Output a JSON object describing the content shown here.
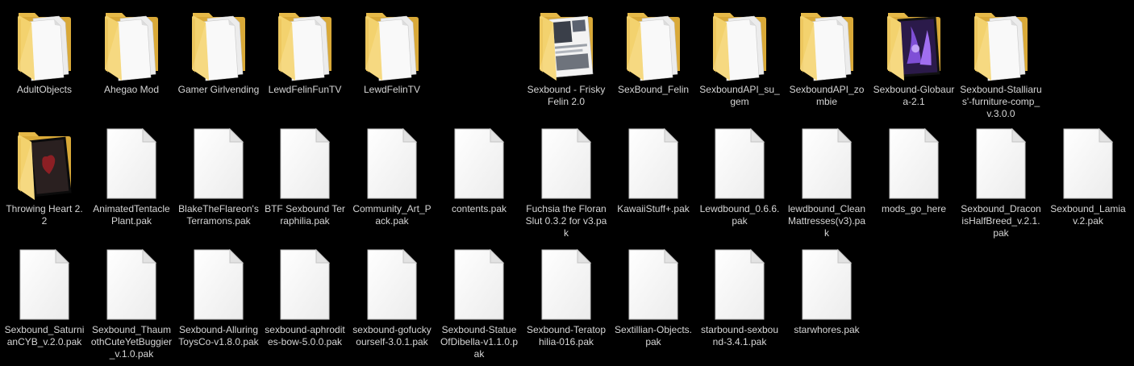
{
  "view": "large-icons",
  "colors": {
    "background": "#000000",
    "label_text": "#d6d6d6",
    "folder_yellow": "#f3d26e",
    "folder_dark": "#d9a938",
    "paper": "#f7f7f7"
  },
  "rows": [
    {
      "items": [
        {
          "label": "AdultObjects",
          "type": "folder",
          "icon": "folder-icon",
          "col": 0
        },
        {
          "label": "Ahegao Mod",
          "type": "folder",
          "icon": "folder-icon",
          "col": 1
        },
        {
          "label": "Gamer Girlvending",
          "type": "folder",
          "icon": "folder-icon",
          "col": 2
        },
        {
          "label": "LewdFelinFunTV",
          "type": "folder",
          "icon": "folder-icon",
          "col": 3
        },
        {
          "label": "LewdFelinTV",
          "type": "folder",
          "icon": "folder-icon",
          "col": 4
        },
        {
          "label": "Sexbound - Frisky Felin 2.0",
          "type": "folder-preview",
          "preview": "light",
          "icon": "folder-preview-icon",
          "col": 6
        },
        {
          "label": "SexBound_Felin",
          "type": "folder",
          "icon": "folder-icon",
          "col": 7
        },
        {
          "label": "SexboundAPI_su_gem",
          "type": "folder",
          "icon": "folder-icon",
          "col": 8
        },
        {
          "label": "SexboundAPI_zombie",
          "type": "folder",
          "icon": "folder-icon",
          "col": 9
        },
        {
          "label": "Sexbound-Globaura-2.1",
          "type": "folder-preview",
          "preview": "purple",
          "icon": "folder-preview-icon",
          "col": 10
        },
        {
          "label": "Sexbound-Stalliarus'-furniture-comp_v.3.0.0",
          "type": "folder",
          "icon": "folder-icon",
          "col": 11
        }
      ]
    },
    {
      "items": [
        {
          "label": "Throwing Heart 2.2",
          "type": "folder-preview",
          "preview": "heart",
          "icon": "folder-preview-icon",
          "col": 0
        },
        {
          "label": "AnimatedTentaclePlant.pak",
          "type": "file",
          "icon": "blank-file-icon",
          "col": 1
        },
        {
          "label": "BlakeTheFlareon's Terramons.pak",
          "type": "file",
          "icon": "blank-file-icon",
          "col": 2
        },
        {
          "label": "BTF Sexbound Terraphilia.pak",
          "type": "file",
          "icon": "blank-file-icon",
          "col": 3
        },
        {
          "label": "Community_Art_Pack.pak",
          "type": "file",
          "icon": "blank-file-icon",
          "col": 4
        },
        {
          "label": "contents.pak",
          "type": "file",
          "icon": "blank-file-icon",
          "col": 5
        },
        {
          "label": "Fuchsia the Floran Slut 0.3.2 for v3.pak",
          "type": "file",
          "icon": "blank-file-icon",
          "col": 6
        },
        {
          "label": "KawaiiStuff+.pak",
          "type": "file",
          "icon": "blank-file-icon",
          "col": 7
        },
        {
          "label": "Lewdbound_0.6.6.pak",
          "type": "file",
          "icon": "blank-file-icon",
          "col": 8
        },
        {
          "label": "lewdbound_CleanMattresses(v3).pak",
          "type": "file",
          "icon": "blank-file-icon",
          "col": 9
        },
        {
          "label": "mods_go_here",
          "type": "file",
          "icon": "blank-file-icon",
          "col": 10
        },
        {
          "label": "Sexbound_DraconisHalfBreed_v.2.1.pak",
          "type": "file",
          "icon": "blank-file-icon",
          "col": 11
        },
        {
          "label": "Sexbound_Lamia v.2.pak",
          "type": "file",
          "icon": "blank-file-icon",
          "col": 12
        }
      ]
    },
    {
      "items": [
        {
          "label": "Sexbound_SaturnianCYB_v.2.0.pak",
          "type": "file",
          "icon": "blank-file-icon",
          "col": 0
        },
        {
          "label": "Sexbound_ThaumothCuteYetBuggier_v.1.0.pak",
          "type": "file",
          "icon": "blank-file-icon",
          "col": 1
        },
        {
          "label": "Sexbound-AlluringToysCo-v1.8.0.pak",
          "type": "file",
          "icon": "blank-file-icon",
          "col": 2
        },
        {
          "label": "sexbound-aphrodites-bow-5.0.0.pak",
          "type": "file",
          "icon": "blank-file-icon",
          "col": 3
        },
        {
          "label": "sexbound-gofuckyourself-3.0.1.pak",
          "type": "file",
          "icon": "blank-file-icon",
          "col": 4
        },
        {
          "label": "Sexbound-StatueOfDibella-v1.1.0.pak",
          "type": "file",
          "icon": "blank-file-icon",
          "col": 5
        },
        {
          "label": "Sexbound-Teratophilia-016.pak",
          "type": "file",
          "icon": "blank-file-icon",
          "col": 6
        },
        {
          "label": "Sextillian-Objects.pak",
          "type": "file",
          "icon": "blank-file-icon",
          "col": 7
        },
        {
          "label": "starbound-sexbound-3.4.1.pak",
          "type": "file",
          "icon": "blank-file-icon",
          "col": 8
        },
        {
          "label": "starwhores.pak",
          "type": "file",
          "icon": "blank-file-icon",
          "col": 9
        }
      ]
    }
  ]
}
